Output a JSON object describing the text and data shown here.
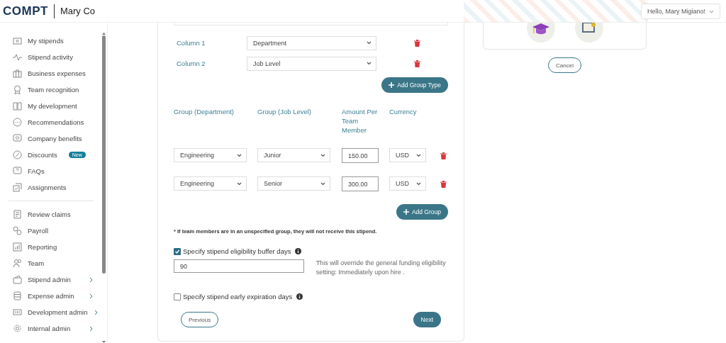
{
  "header": {
    "logo": "COMPT",
    "company": "Mary Co",
    "user_menu": "Hello, Mary Migiano!"
  },
  "sidebar": {
    "sections": [
      {
        "items": [
          {
            "label": "My stipends",
            "has_submenu": false
          },
          {
            "label": "Stipend activity",
            "has_submenu": false
          },
          {
            "label": "Business expenses",
            "has_submenu": false
          },
          {
            "label": "Team recognition",
            "has_submenu": false
          },
          {
            "label": "My development",
            "has_submenu": false
          },
          {
            "label": "Recommendations",
            "has_submenu": false
          },
          {
            "label": "Company benefits",
            "has_submenu": false
          },
          {
            "label": "Discounts",
            "badge": "New",
            "has_submenu": false
          },
          {
            "label": "FAQs",
            "has_submenu": false
          },
          {
            "label": "Assignments",
            "has_submenu": false
          }
        ]
      },
      {
        "items": [
          {
            "label": "Review claims",
            "has_submenu": false
          },
          {
            "label": "Payroll",
            "has_submenu": false
          },
          {
            "label": "Reporting",
            "has_submenu": false
          },
          {
            "label": "Team",
            "has_submenu": false
          },
          {
            "label": "Stipend admin",
            "has_submenu": true
          },
          {
            "label": "Expense admin",
            "has_submenu": true
          },
          {
            "label": "Development admin",
            "has_submenu": true
          },
          {
            "label": "Internal admin",
            "has_submenu": true
          }
        ]
      }
    ]
  },
  "group_types": [
    {
      "label": "Column 1",
      "value": "Department"
    },
    {
      "label": "Column 2",
      "value": "Job Level"
    }
  ],
  "add_group_type_button": "Add Group Type",
  "groups": {
    "columns": [
      "Group (Department)",
      "Group (Job Level)",
      "Amount Per Team Member",
      "Currency"
    ],
    "rows": [
      {
        "department": "Engineering",
        "job_level": "Junior",
        "amount": "150.00",
        "currency": "USD"
      },
      {
        "department": "Engineering",
        "job_level": "Senior",
        "amount": "300.00",
        "currency": "USD"
      }
    ]
  },
  "add_group_button": "Add Group",
  "note": "* If team members are in an unspecified group, they will not receive this stipend.",
  "options": [
    {
      "label": "Specify stipend eligibility buffer days",
      "checked": true,
      "value": "90",
      "hint": "This will override the general funding eligibility setting: Immediately upon hire ."
    },
    {
      "label": "Specify stipend early expiration days",
      "checked": false
    }
  ],
  "previous_button": "Previous",
  "next_button": "Next",
  "cancel_button": "Cancel"
}
